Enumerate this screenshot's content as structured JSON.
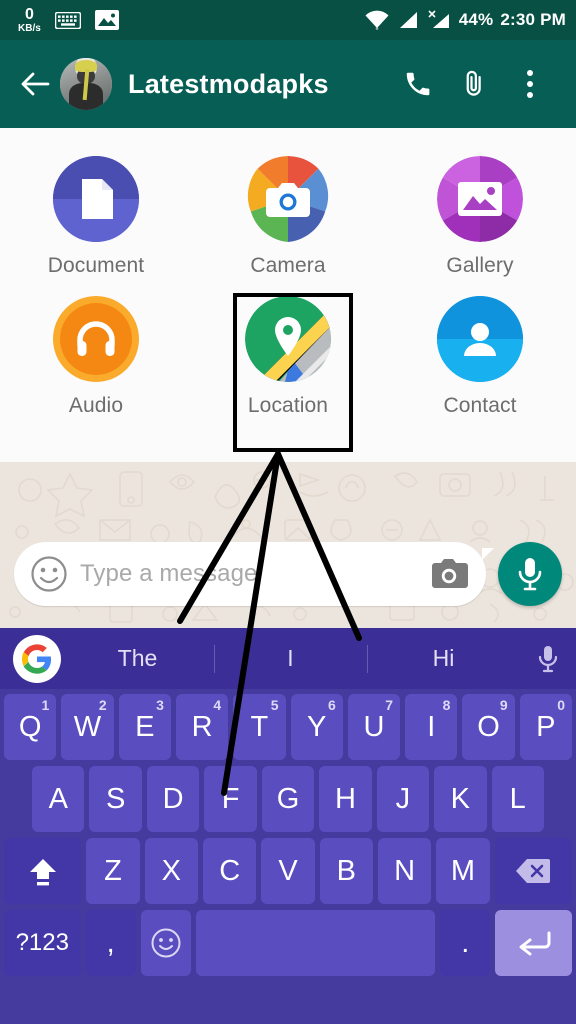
{
  "status_bar": {
    "net_speed_value": "0",
    "net_speed_unit": "KB/s",
    "keyboard_icon": "keyboard-icon",
    "image_icon": "image-icon",
    "wifi_icon": "wifi-icon",
    "signal_icon": "signal-icon",
    "signal_nosim_icon": "signal-no-sim-icon",
    "battery": "44%",
    "time": "2:30 PM"
  },
  "app_bar": {
    "back_icon": "back-arrow-icon",
    "avatar": "contact-avatar",
    "title": "Latestmodapks",
    "call_icon": "phone-call-icon",
    "attach_icon": "paperclip-icon",
    "menu_icon": "overflow-menu-icon",
    "colors": {
      "bar": "#075E54",
      "status": "#075043"
    }
  },
  "attach_panel": {
    "items": [
      {
        "label": "Document",
        "icon": "document-icon",
        "color": "#4f53b8"
      },
      {
        "label": "Camera",
        "icon": "camera-icon",
        "color": "#e8613c"
      },
      {
        "label": "Gallery",
        "icon": "gallery-icon",
        "color": "#b13fc4"
      },
      {
        "label": "Audio",
        "icon": "audio-headphones-icon",
        "color": "#f4971b"
      },
      {
        "label": "Location",
        "icon": "location-pin-map-icon",
        "color": "#1da462"
      },
      {
        "label": "Contact",
        "icon": "contact-person-icon",
        "color": "#139ae4"
      }
    ],
    "highlighted_item": "Location",
    "highlight_color": "#000000"
  },
  "composer": {
    "emoji_icon": "emoji-smiley-icon",
    "placeholder": "Type a message",
    "value": "",
    "camera_icon": "camera-icon",
    "mic_icon": "microphone-icon",
    "mic_color": "#00897B"
  },
  "keyboard": {
    "suggestion_logo": "google-g-icon",
    "suggestions": [
      "The",
      "I",
      "Hi"
    ],
    "voice_icon": "microphone-icon",
    "row1": [
      {
        "key": "Q",
        "sup": "1"
      },
      {
        "key": "W",
        "sup": "2"
      },
      {
        "key": "E",
        "sup": "3"
      },
      {
        "key": "R",
        "sup": "4"
      },
      {
        "key": "T",
        "sup": "5"
      },
      {
        "key": "Y",
        "sup": "6"
      },
      {
        "key": "U",
        "sup": "7"
      },
      {
        "key": "I",
        "sup": "8"
      },
      {
        "key": "O",
        "sup": "9"
      },
      {
        "key": "P",
        "sup": "0"
      }
    ],
    "row2": [
      "A",
      "S",
      "D",
      "F",
      "G",
      "H",
      "J",
      "K",
      "L"
    ],
    "row3": {
      "shift_icon": "shift-arrow-icon",
      "keys": [
        "Z",
        "X",
        "C",
        "V",
        "B",
        "N",
        "M"
      ],
      "backspace_icon": "backspace-delete-icon"
    },
    "row4": {
      "symbols": "?123",
      "comma": ",",
      "emoji_icon": "emoji-smiley-icon",
      "space": "",
      "period": ".",
      "enter_icon": "enter-return-icon"
    },
    "colors": {
      "bg": "#453a9e",
      "key": "#5a4dc0",
      "key_dark": "#4337a8",
      "enter": "#9d8fe0",
      "suggestion_bar": "#3b2f97"
    }
  },
  "annotation": {
    "type": "pointer-lines",
    "color": "#000000",
    "target": "Location",
    "line_count": 3
  }
}
